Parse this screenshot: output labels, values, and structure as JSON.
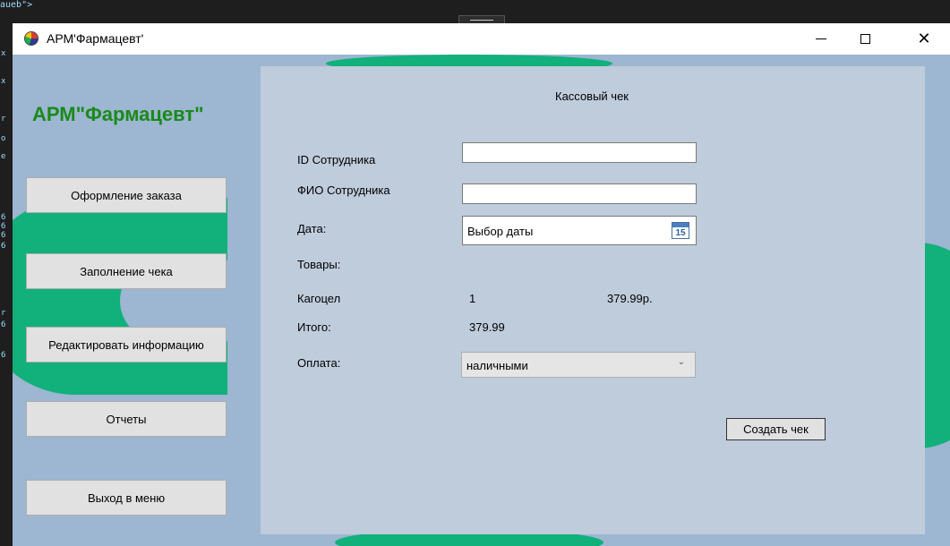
{
  "editor": {
    "top_snippet": "aueb\">",
    "margin_chars": [
      "x",
      "x",
      "r",
      "o",
      "e",
      "6",
      "6",
      "6",
      "6",
      "r",
      "6",
      "6"
    ]
  },
  "window": {
    "title": "АРМ'Фармацевт'",
    "controls": {
      "minimize": "—",
      "maximize": "☐",
      "close": "✕"
    }
  },
  "app": {
    "header": "АРМ\"Фармацевт\""
  },
  "nav": {
    "items": [
      {
        "label": "Оформление заказа"
      },
      {
        "label": "Заполнение чека"
      },
      {
        "label": "Редактировать информацию"
      },
      {
        "label": "Отчеты"
      },
      {
        "label": "Выход в меню"
      }
    ]
  },
  "receipt": {
    "title": "Кассовый чек",
    "employee_id_label": "ID Сотрудника",
    "employee_id_value": "",
    "employee_name_label": "ФИО Сотрудника",
    "employee_name_value": "",
    "date_label": "Дата:",
    "date_placeholder": "Выбор даты",
    "calendar_day": "15",
    "goods_label": "Товары:",
    "item_name": "Кагоцел",
    "item_qty": "1",
    "item_price": "379.99р.",
    "total_label": "Итого:",
    "total_value": "379.99",
    "payment_label": "Оплата:",
    "payment_selected": "наличными",
    "create_button": "Создать чек"
  }
}
